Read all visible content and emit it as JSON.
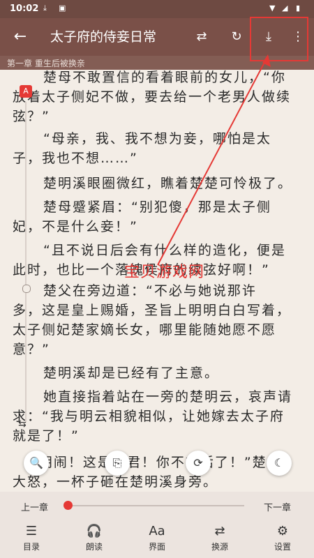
{
  "status": {
    "time": "10:02"
  },
  "header": {
    "title": "太子府的侍妾日常",
    "back_icon": "←",
    "swap_icon": "⇄",
    "refresh_icon": "↻",
    "download_icon": "⤓",
    "more_icon": "⋮"
  },
  "chapter": {
    "title": "第一章 重生后被换亲"
  },
  "content": {
    "lines": [
      "楚母不敢置信的看着眼前的女儿，“你",
      "放着太子侧妃不做，要去给一个老男人做续",
      "弦？”",
      "“母亲，我、我不想为妾，哪怕是太",
      "子，我也不想……”",
      "楚明溪眼圈微红，瞧着楚楚可怜极了。",
      "楚母蹙紧眉：“别犯傻，那是太子侧",
      "妃，不是什么妾！”",
      "“且不说日后会有什么样的造化，便是",
      "此时，也比一个落魄侯府的续弦好啊！”",
      "楚父在旁边道：“不必与她说那许",
      "多，这是皇上赐婚，圣旨上明明白白写着，",
      "太子侧妃楚家嫡长女，哪里能随她愿不愿",
      "意？”",
      "楚明溪却是已经有了主意。",
      "她直接指着站在一旁的楚明云，哀声请",
      "求：“我与明云相貌相似，让她嫁去太子府",
      "就是了！”",
      "“胡闹！这是欺君！你不想活了！”楚父",
      "大怒，一杯子砸在楚明溪身旁。"
    ]
  },
  "watermark": "宝贝游戏网",
  "overlay": {
    "badge": "A"
  },
  "fabs": {
    "a": "🔍",
    "b": "⎘",
    "c": "⟳",
    "d": "☾"
  },
  "footer": {
    "prev": "上一章",
    "next": "下一章",
    "progress": 0.0,
    "nav": [
      {
        "icon": "☰",
        "label": "目录"
      },
      {
        "icon": "🎧",
        "label": "朗读"
      },
      {
        "icon": "Aa",
        "label": "界面"
      },
      {
        "icon": "⇄",
        "label": "换源"
      },
      {
        "icon": "⚙",
        "label": "设置"
      }
    ]
  }
}
